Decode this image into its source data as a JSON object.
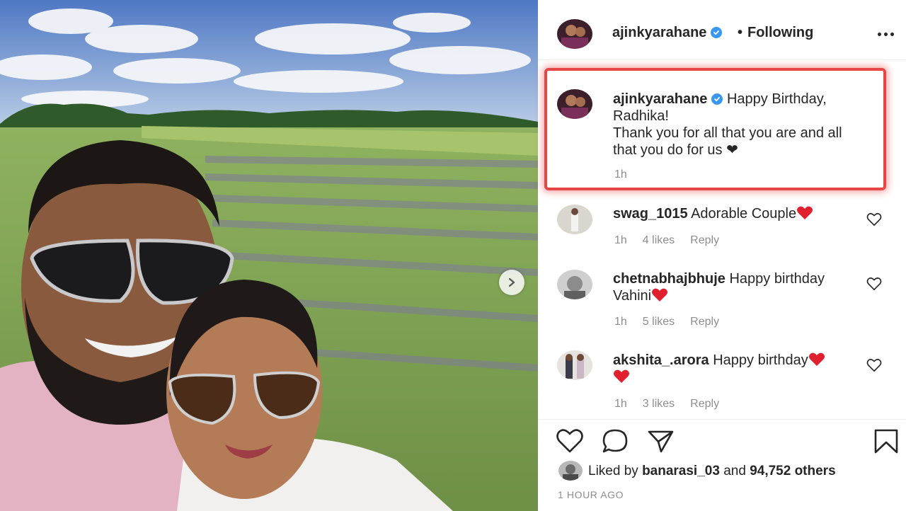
{
  "post": {
    "author": "ajinkyarahane",
    "separator": "•",
    "follow_status": "Following"
  },
  "caption": {
    "author": "ajinkyarahane",
    "text_line1": "Happy Birthday,",
    "text_line2": "Radhika!",
    "text_line3": "Thank you for all that you are and all",
    "text_line4": "that you do for us ❤",
    "time": "1h"
  },
  "comments": [
    {
      "user": "swag_1015",
      "text": "Adorable Couple",
      "time": "1h",
      "likes": "4 likes",
      "reply": "Reply"
    },
    {
      "user": "chetnabhajbhuje",
      "text": "Happy birthday",
      "text2": "Vahini",
      "time": "1h",
      "likes": "5 likes",
      "reply": "Reply"
    },
    {
      "user": "akshita_.arora",
      "text": "Happy birthday",
      "time": "1h",
      "likes": "3 likes",
      "reply": "Reply"
    }
  ],
  "likes": {
    "prefix": "Liked by",
    "user": "banarasi_03",
    "middle": "and",
    "others": "94,752 others"
  },
  "timestamp": "1 HOUR AGO",
  "icons": {
    "verified": "verified-badge-icon",
    "more": "more-options-icon",
    "like": "heart-icon",
    "comment": "comment-bubble-icon",
    "share": "paper-plane-icon",
    "save": "bookmark-icon",
    "next": "chevron-right-icon"
  },
  "colors": {
    "highlight_border": "#e64646",
    "verified_blue": "#3897f0",
    "heart_red": "#ed4956",
    "secondary_text": "#8e8e8e"
  }
}
